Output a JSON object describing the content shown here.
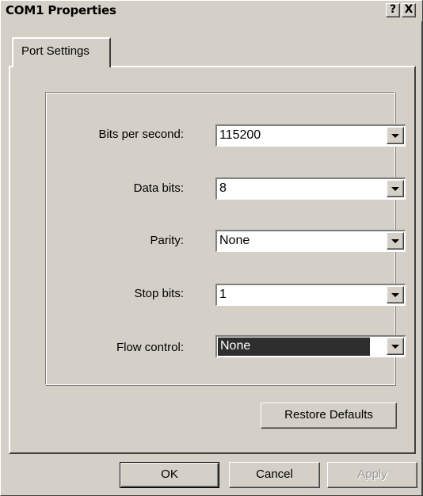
{
  "window": {
    "title": "COM1 Properties",
    "help_label": "?",
    "close_label": "X"
  },
  "tabs": [
    {
      "label": "Port Settings",
      "selected": true
    }
  ],
  "fields": [
    {
      "label": "Bits per second:",
      "value": "115200"
    },
    {
      "label": "Data bits:",
      "value": "8"
    },
    {
      "label": "Parity:",
      "value": "None"
    },
    {
      "label": "Stop bits:",
      "value": "1"
    },
    {
      "label": "Flow control:",
      "value": "None",
      "selected": true
    }
  ],
  "buttons": {
    "restore_defaults": "Restore Defaults",
    "ok": "OK",
    "cancel": "Cancel",
    "apply": "Apply"
  },
  "icons": {
    "dropdown": "chevron-down-icon",
    "help": "question-icon",
    "close": "close-icon"
  },
  "colors": {
    "face": "#d4d0c8",
    "highlight_selection": "#2e2e2e"
  }
}
